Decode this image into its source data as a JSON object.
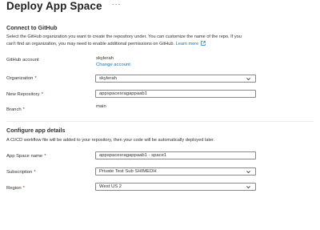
{
  "page": {
    "title": "Deploy App Space",
    "more_label": "···"
  },
  "github_section": {
    "title": "Connect to GitHub",
    "description_line1": "Select the GitHub organization you want to create the repository under. You can customize the name of the repo. If you",
    "description_line2": "can't find an organization, you may need to enable additional permissions on GitHub.",
    "learn_more": "Learn more",
    "account_label": "GitHub account",
    "account_value": "skylerah",
    "change_account": "Change account",
    "organization_label": "Organization",
    "organization_value": "skylerah",
    "repository_label": "New Repository",
    "repository_value": "appspacesragappaab1",
    "branch_label": "Branch",
    "branch_value": "main"
  },
  "app_section": {
    "title": "Configure app details",
    "description": "A CI/CD workflow file will be added to your repository, then your code will be automatically deployed later.",
    "name_label": "App Space name",
    "name_value": "appspacesragappaab1 - space1",
    "subscription_label": "Subscription",
    "subscription_value": "Private Test Sub SHIMEDH",
    "region_label": "Region",
    "region_value": "West US 2"
  },
  "required_marker": "*",
  "icons": {
    "more": "ellipsis-icon",
    "external": "external-link-icon",
    "dropdown": "chevron-down-icon"
  },
  "colors": {
    "link": "#0078d4",
    "required": "#a4262c",
    "border": "#8a8886"
  }
}
